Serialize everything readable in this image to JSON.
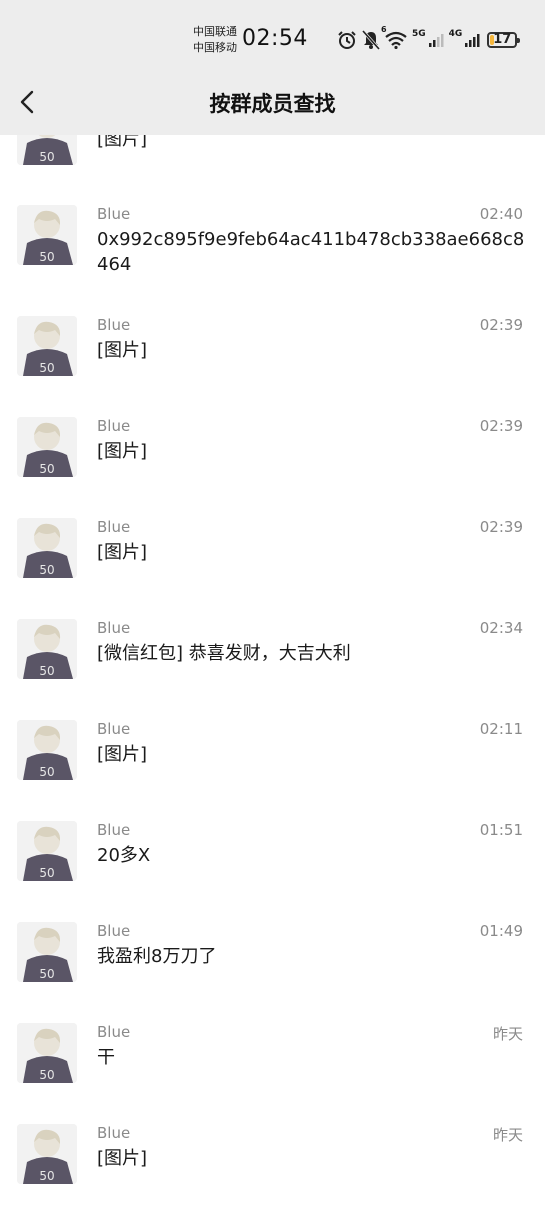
{
  "status_bar": {
    "carrier1": "中国联通",
    "carrier2": "中国移动",
    "time": "02:54",
    "network1": "5G",
    "network2": "4G",
    "wifi_label": "6",
    "battery": "17",
    "battery_color": "#f6b73c"
  },
  "nav": {
    "title": "按群成员查找",
    "back_icon": "chevron-left"
  },
  "messages": [
    {
      "name": "",
      "time": "",
      "text": "[图片]"
    },
    {
      "name": "Blue",
      "time": "02:40",
      "text": "0x992c895f9e9feb64ac411b478cb338ae668c8464"
    },
    {
      "name": "Blue",
      "time": "02:39",
      "text": "[图片]"
    },
    {
      "name": "Blue",
      "time": "02:39",
      "text": "[图片]"
    },
    {
      "name": "Blue",
      "time": "02:39",
      "text": "[图片]"
    },
    {
      "name": "Blue",
      "time": "02:34",
      "text": "[微信红包] 恭喜发财，大吉大利"
    },
    {
      "name": "Blue",
      "time": "02:11",
      "text": "[图片]"
    },
    {
      "name": "Blue",
      "time": "01:51",
      "text": "20多X"
    },
    {
      "name": "Blue",
      "time": "01:49",
      "text": "我盈利8万刀了"
    },
    {
      "name": "Blue",
      "time": "昨天",
      "text": "干"
    },
    {
      "name": "Blue",
      "time": "昨天",
      "text": "[图片]"
    }
  ]
}
